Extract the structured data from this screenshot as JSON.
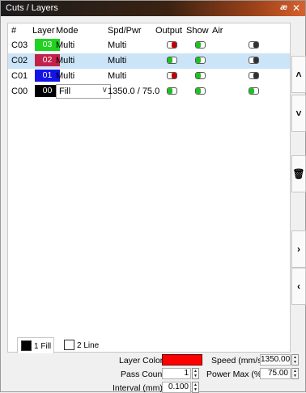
{
  "window": {
    "title": "Cuts / Layers",
    "pin_glyph": "æ",
    "close_glyph": "✕"
  },
  "grid": {
    "headers": [
      "#",
      "Layer",
      "Mode",
      "Spd/Pwr",
      "Output",
      "Show",
      "Air"
    ],
    "rows": [
      {
        "id": "C03",
        "layer": "03",
        "color": "#21d321",
        "mode": "Multi",
        "spdpwr": "Multi",
        "output": "red",
        "show": "on",
        "air": "off",
        "selected": false
      },
      {
        "id": "C02",
        "layer": "02",
        "color": "#c2224a",
        "mode": "Multi",
        "spdpwr": "Multi",
        "output": "on",
        "show": "on",
        "air": "off",
        "selected": true
      },
      {
        "id": "C01",
        "layer": "01",
        "color": "#1414e6",
        "mode": "Multi",
        "spdpwr": "Multi",
        "output": "red",
        "show": "on",
        "air": "off",
        "selected": false
      },
      {
        "id": "C00",
        "layer": "00",
        "color": "#000000",
        "mode": "Fill",
        "spdpwr": "1350.0 / 75.0",
        "output": "on",
        "show": "on",
        "air": "on",
        "selected": false,
        "mode_dropdown": true
      }
    ]
  },
  "side_buttons": [
    {
      "name": "move-up-button",
      "glyph": "˄"
    },
    {
      "name": "move-down-button",
      "glyph": "˅"
    },
    {
      "name": "delete-layer-button",
      "glyph": "🗑"
    },
    {
      "name": "push-right-button",
      "glyph": "›"
    },
    {
      "name": "pull-left-button",
      "glyph": "‹"
    }
  ],
  "tabs": [
    {
      "label": "1 Fill",
      "swatch": "#000000",
      "active": true
    },
    {
      "label": "2 Line",
      "swatch": "#ffffff",
      "active": false
    }
  ],
  "props": {
    "layer_color_label": "Layer Color",
    "layer_color": "#ff0000",
    "pass_count_label": "Pass Count",
    "pass_count": "1",
    "interval_label": "Interval (mm)",
    "interval": "0.100",
    "speed_label": "Speed (mm/s)",
    "speed": "1350.00",
    "power_max_label": "Power Max (%)",
    "power_max": "75.00"
  }
}
